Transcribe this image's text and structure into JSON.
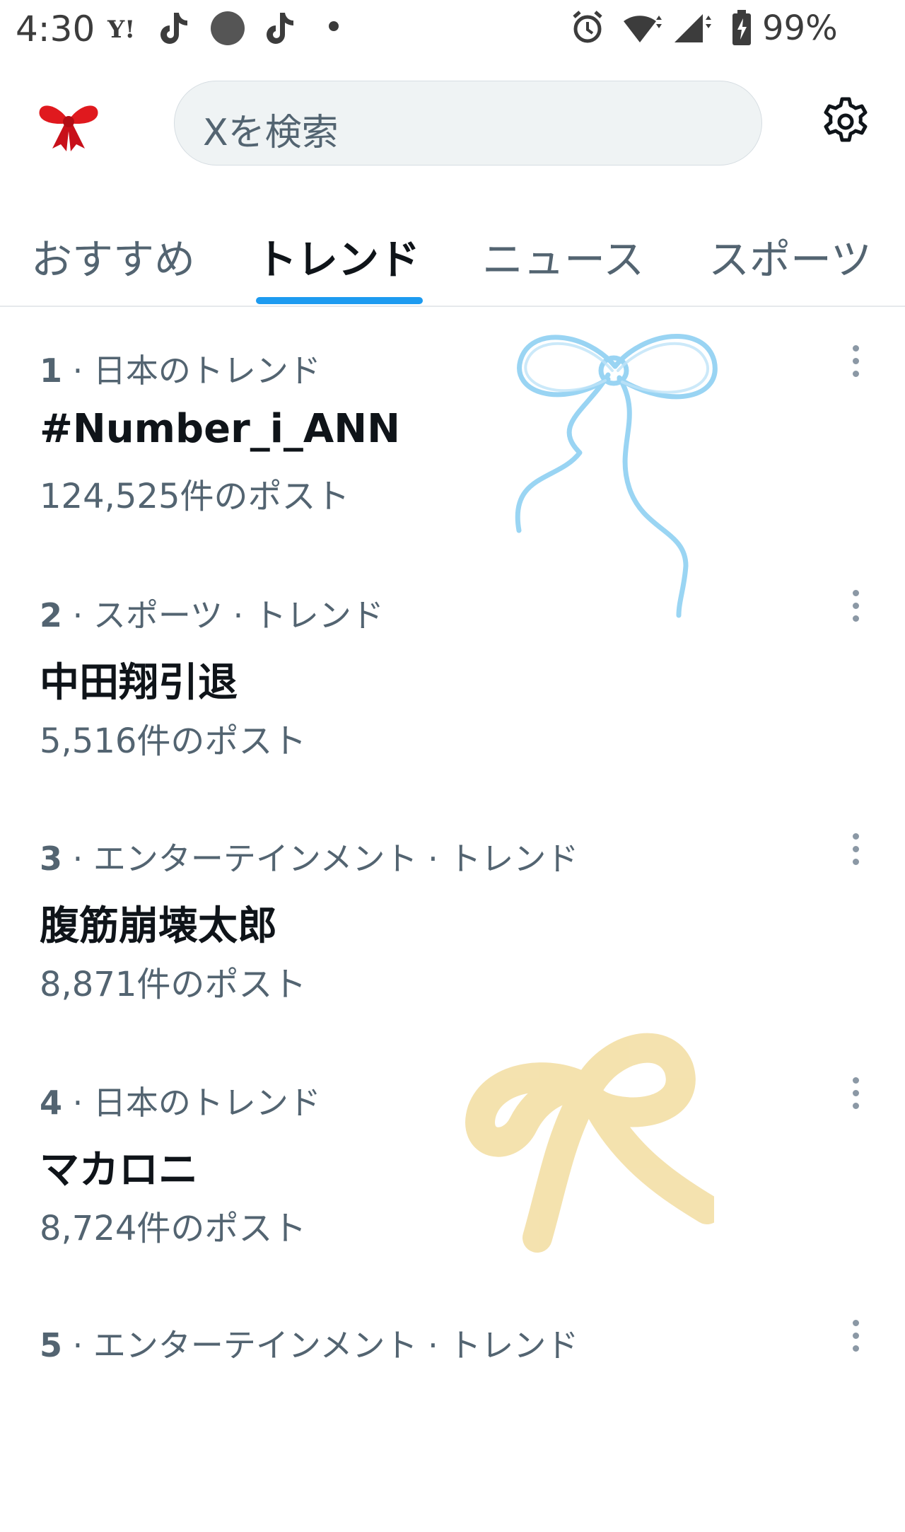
{
  "status_bar": {
    "time": "4:30",
    "yahoo_label": "Y!",
    "battery": "99%",
    "icons": [
      "yahoo-icon",
      "tiktok-icon",
      "circle-icon",
      "tiktok-icon",
      "dot-icon",
      "alarm-icon",
      "wifi-icon",
      "signal-icon",
      "battery-icon"
    ]
  },
  "header": {
    "logo_icon": "red-ribbon-icon",
    "search_placeholder": "Xを検索",
    "settings_icon": "gear-icon"
  },
  "tabs": [
    {
      "label": "おすすめ",
      "active": false
    },
    {
      "label": "トレンド",
      "active": true
    },
    {
      "label": "ニュース",
      "active": false
    },
    {
      "label": "スポーツ",
      "active": false
    }
  ],
  "trends": [
    {
      "rank": "1",
      "category": "日本のトレンド",
      "name": "#Number_i_ANN",
      "posts": "124,525件のポスト"
    },
    {
      "rank": "2",
      "category": "スポーツ · トレンド",
      "name": "中田翔引退",
      "posts": "5,516件のポスト"
    },
    {
      "rank": "3",
      "category": "エンターテインメント · トレンド",
      "name": "腹筋崩壊太郎",
      "posts": "8,871件のポスト"
    },
    {
      "rank": "4",
      "category": "日本のトレンド",
      "name": "マカロニ",
      "posts": "8,724件のポスト"
    },
    {
      "rank": "5",
      "category": "エンターテインメント · トレンド",
      "name": "",
      "posts": ""
    }
  ],
  "colors": {
    "accent": "#1d9bf0",
    "ribbon_blue": "#8fd0f2",
    "ribbon_yellow": "#f3dfa6",
    "ribbon_red": "#e0191e"
  }
}
